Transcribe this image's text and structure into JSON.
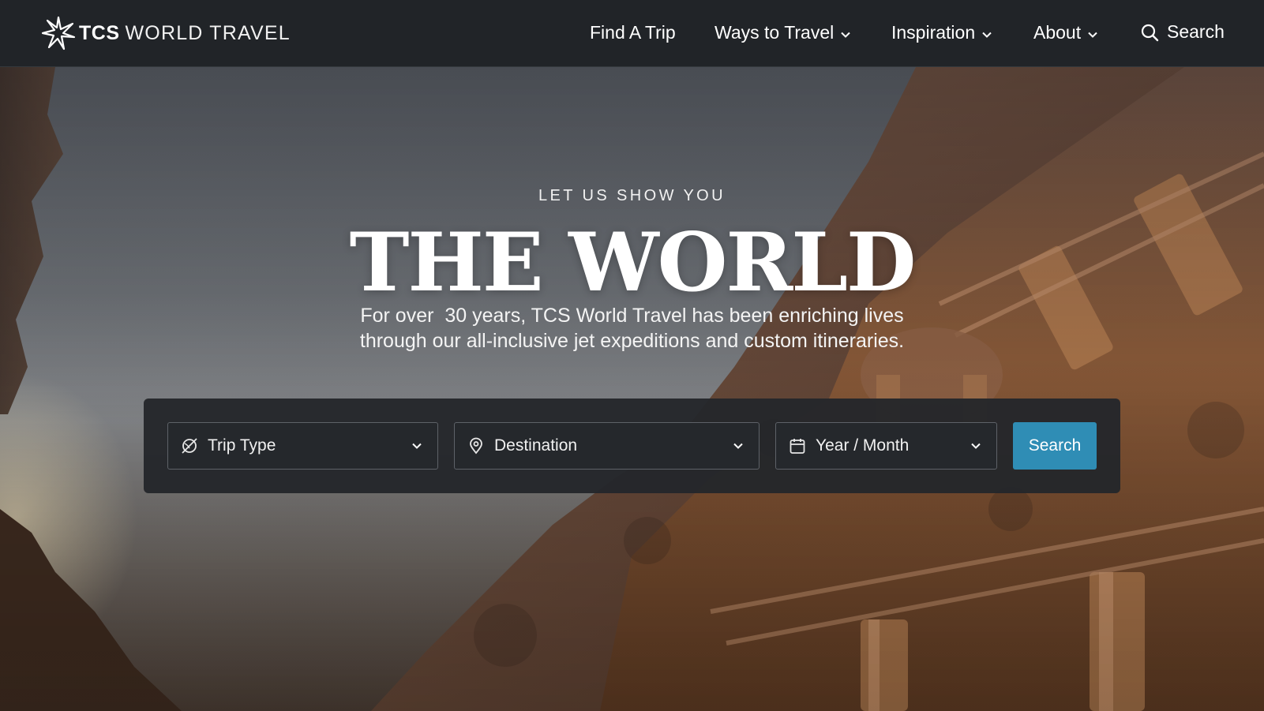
{
  "brand": {
    "bold": "TCS",
    "light": "WORLD TRAVEL",
    "icon": "star-burst-icon"
  },
  "nav": {
    "items": [
      {
        "label": "Find A Trip",
        "has_dropdown": false
      },
      {
        "label": "Ways to Travel",
        "has_dropdown": true
      },
      {
        "label": "Inspiration",
        "has_dropdown": true
      },
      {
        "label": "About",
        "has_dropdown": true
      }
    ],
    "search_label": "Search"
  },
  "hero": {
    "eyebrow": "LET US SHOW YOU",
    "headline": "THE WORLD",
    "tagline_line1": "For over  30 years, TCS World Travel has been enriching lives",
    "tagline_line2": "through our all-inclusive jet expeditions and custom itineraries."
  },
  "search_panel": {
    "trip_type": {
      "label": "Trip Type",
      "icon": "globe-slash-icon"
    },
    "destination": {
      "label": "Destination",
      "icon": "map-pin-icon"
    },
    "date": {
      "label": "Year / Month",
      "icon": "calendar-icon"
    },
    "submit_label": "Search"
  },
  "colors": {
    "nav_bg": "#212428",
    "panel_bg": "#24272b",
    "accent": "#2f8db5"
  }
}
